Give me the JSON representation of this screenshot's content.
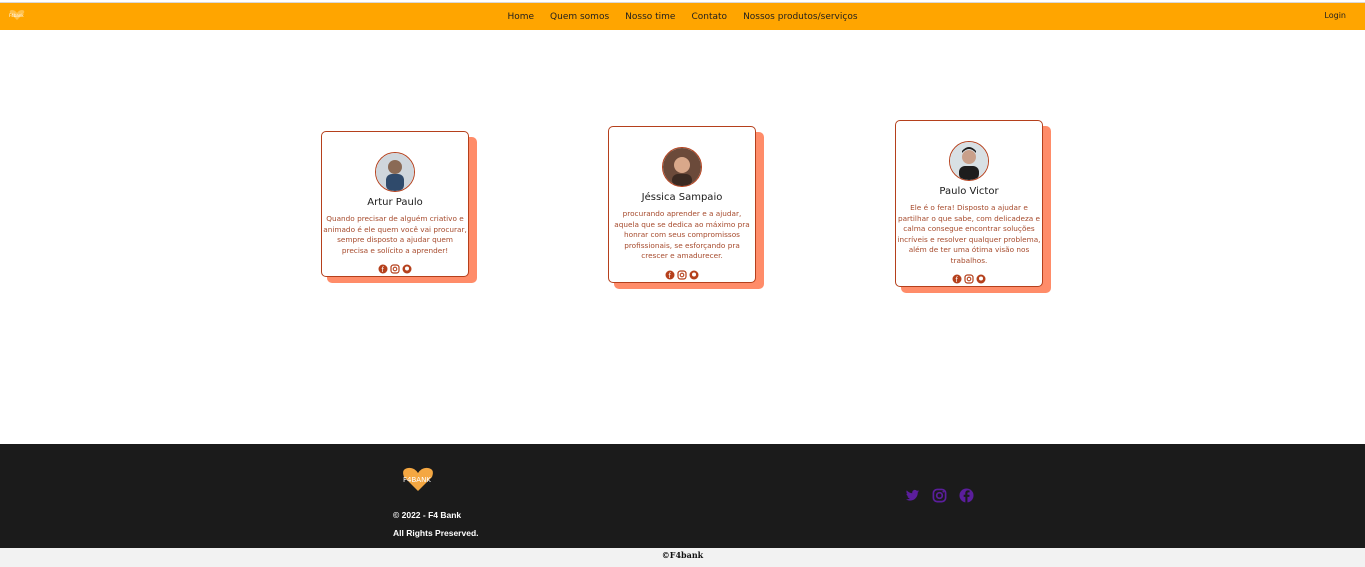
{
  "nav": {
    "items": [
      {
        "label": "Home"
      },
      {
        "label": "Quem somos"
      },
      {
        "label": "Nosso time"
      },
      {
        "label": "Contato"
      },
      {
        "label": "Nossos produtos/serviços"
      }
    ],
    "login_label": "Login"
  },
  "team": [
    {
      "name": "Artur Paulo",
      "description": "Quando precisar de alguém criativo e animado é ele quem você vai procurar, sempre disposto a ajudar quem precisa e solícito a aprender!"
    },
    {
      "name": "Jéssica Sampaio",
      "description": "procurando aprender e a ajudar, aquela que se dedica ao máximo pra honrar com seus compromissos profissionais, se esforçando pra crescer e amadurecer."
    },
    {
      "name": "Paulo Victor",
      "description": "Ele é o fera! Disposto a ajudar e partilhar o que sabe, com delicadeza e calma consegue encontrar soluções incríveis e resolver qualquer problema, além de ter uma ótima visão nos trabalhos."
    }
  ],
  "footer": {
    "copyright": "© 2022 - F4 Bank",
    "rights": "All Rights Preserved.",
    "social_icons": [
      "twitter-icon",
      "instagram-icon",
      "facebook-icon"
    ],
    "social_color": "#5b1e9c"
  },
  "bottom": {
    "text": "©F4bank"
  },
  "colors": {
    "navbar": "#ffa500",
    "card_border": "#b5401c",
    "card_shadow": "#ff8c69",
    "footer": "#1b1b1b"
  }
}
